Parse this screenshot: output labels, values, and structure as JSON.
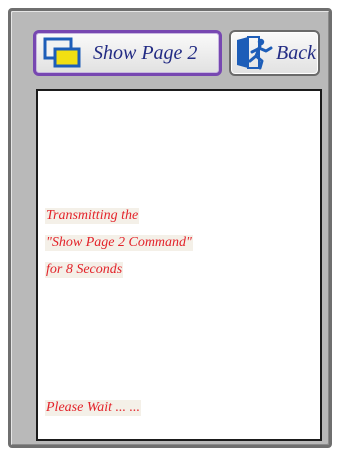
{
  "toolbar": {
    "show_page_label": "Show Page 2",
    "back_label": "Back",
    "show_page_icon": "pages-icon",
    "back_icon": "exit-icon"
  },
  "content": {
    "message_lines": [
      "Transmitting the",
      "\"Show Page 2 Command\"",
      "for 8 Seconds"
    ],
    "wait_text": "Please Wait ... ..."
  },
  "colors": {
    "frame": "#b9b9b9",
    "accent_border": "#7747b1",
    "label_text": "#232c84",
    "message_text": "#e3232a",
    "icon_blue": "#1d5db8",
    "icon_yellow": "#f2df12"
  }
}
